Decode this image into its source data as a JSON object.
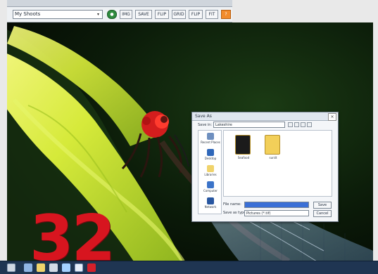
{
  "window": {
    "title": "",
    "path_value": "My Shoots",
    "toolbar_buttons": [
      "●",
      "IMG",
      "SAVE",
      "FLIP",
      "GRID",
      "FLIP",
      "FIT",
      "?"
    ]
  },
  "cover_number": "32",
  "dialog": {
    "title": "Save As",
    "close": "×",
    "look_in_label": "Save in:",
    "look_in_value": "Lakeshire",
    "sidebar": [
      {
        "label": "Recent Places"
      },
      {
        "label": "Desktop"
      },
      {
        "label": "Libraries"
      },
      {
        "label": "Computer"
      },
      {
        "label": "Network"
      }
    ],
    "files": [
      {
        "label": "Seafood",
        "color": "#1b1b1b"
      },
      {
        "label": "sunlit",
        "color": "#f2cf59"
      }
    ],
    "file_name_label": "File name:",
    "file_name_value": "",
    "save_type_label": "Save as type:",
    "save_type_value": "Pictures (*.tif)",
    "save_button": "Save",
    "cancel_button": "Cancel"
  },
  "taskbar": {
    "items": [
      "start",
      "app1",
      "app2",
      "app3",
      "app4",
      "app5",
      "app6"
    ]
  }
}
